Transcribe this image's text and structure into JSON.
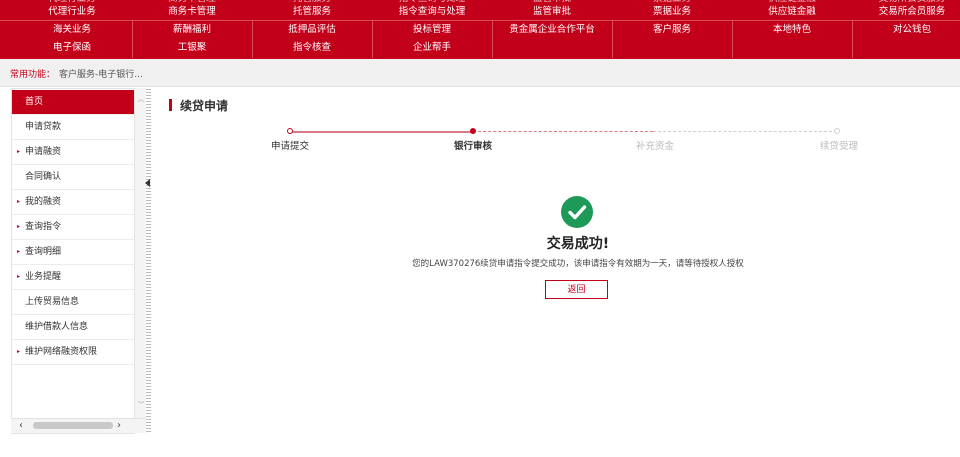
{
  "topnav": {
    "row0": [
      "代理行业务",
      "商务卡管理",
      "托管服务",
      "指令查询与处理",
      "监管审批",
      "票据业务",
      "供应链金融",
      "交易所会员服务"
    ],
    "row1": [
      "代理行业务",
      "商务卡管理",
      "托管服务",
      "指令查询与处理",
      "监管审批",
      "票据业务",
      "供应链金融",
      "交易所会员服务"
    ],
    "row2": [
      "海关业务",
      "薪酬福利",
      "抵押品评估",
      "投标管理",
      "贵金属企业合作平台",
      "客户服务",
      "本地特色",
      "对公钱包"
    ],
    "row3": [
      "电子保函",
      "工银聚",
      "指令核查",
      "企业帮手"
    ]
  },
  "breadcrumb": {
    "label": "常用功能：",
    "item": "客户服务-电子银行..."
  },
  "sidebar": {
    "items": [
      {
        "label": "首页",
        "arrow": ""
      },
      {
        "label": "申请贷款",
        "arrow": ""
      },
      {
        "label": "申请融资",
        "arrow": "▸"
      },
      {
        "label": "合同确认",
        "arrow": ""
      },
      {
        "label": "我的融资",
        "arrow": "▸"
      },
      {
        "label": "查询指令",
        "arrow": "▸"
      },
      {
        "label": "查询明细",
        "arrow": "▸"
      },
      {
        "label": "业务提醒",
        "arrow": "▸"
      },
      {
        "label": "上传贸易信息",
        "arrow": ""
      },
      {
        "label": "维护借款人信息",
        "arrow": ""
      },
      {
        "label": "维护网络融资权限",
        "arrow": "▸"
      }
    ]
  },
  "main": {
    "title": "续贷申请",
    "steps": [
      {
        "label": "申请提交"
      },
      {
        "label": "银行审核"
      },
      {
        "label": "补充资金"
      },
      {
        "label": "续贷受理"
      }
    ],
    "success_message": "交易成功!",
    "detail": "您的LAW370276续贷申请指令提交成功，该申请指令有效期为一天，请等待授权人授权",
    "back_button": "返回"
  },
  "colors": {
    "brand": "#c3001a",
    "success": "#1e9a58",
    "inactive": "#c8c8c8"
  }
}
